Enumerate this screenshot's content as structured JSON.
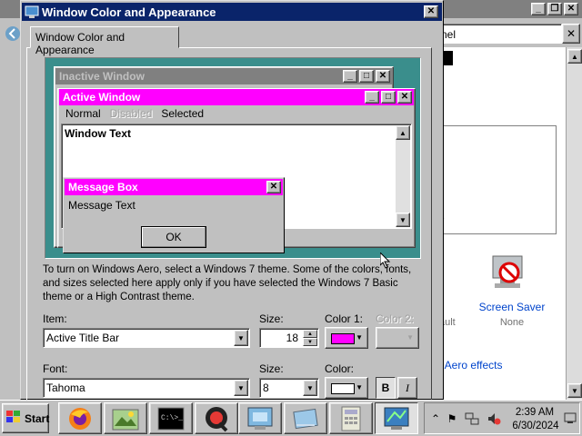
{
  "background_window": {
    "address_text": "nel",
    "screen_saver_label": "Screen Saver",
    "screen_saver_value": "None",
    "partial_default": "ault",
    "partial_e": "e",
    "aero_link": "r Aero effects"
  },
  "dialog": {
    "title": "Window Color and Appearance",
    "tab_label": "Window Color and Appearance",
    "preview": {
      "inactive_title": "Inactive Window",
      "active_title": "Active Window",
      "menu": [
        "Normal",
        "Disabled",
        "Selected"
      ],
      "window_text": "Window Text",
      "message_box_title": "Message Box",
      "message_text": "Message Text",
      "ok_label": "OK"
    },
    "info_text": "To turn on Windows Aero, select a Windows 7 theme.  Some of the colors, fonts, and sizes selected here apply only if you have selected the Windows 7 Basic theme or a High Contrast theme.",
    "item_label": "Item:",
    "item_value": "Active Title Bar",
    "size_label": "Size:",
    "item_size_value": "18",
    "color1_label": "Color 1:",
    "color2_label": "Color 2:",
    "font_label": "Font:",
    "font_value": "Tahoma",
    "font_size_label": "Size:",
    "font_size_value": "8",
    "font_color_label": "Color:",
    "bold_label": "B",
    "italic_label": "I"
  },
  "colors": {
    "active_title": "#ff00ff",
    "inactive_title": "#808080",
    "desktop": "#3a8e8c",
    "dialog_title": "#0a246a",
    "font_color": "#ffffff"
  },
  "taskbar": {
    "start_label": "Start",
    "time": "2:39 AM",
    "date": "6/30/2024",
    "apps": [
      "firefox-icon",
      "image-viewer-icon",
      "terminal-icon",
      "chat-icon",
      "remote-desktop-icon",
      "folder-icon",
      "calculator-icon",
      "display-settings-icon"
    ]
  }
}
